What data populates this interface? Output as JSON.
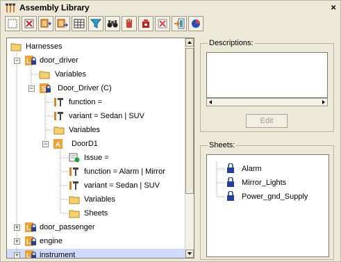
{
  "window": {
    "title": "Assembly Library",
    "close_glyph": "×"
  },
  "toolbar": {
    "buttons": [
      "select-all",
      "delete",
      "copy-to",
      "move-to",
      "table",
      "filter",
      "find",
      "hand",
      "export",
      "remove",
      "import",
      "properties"
    ]
  },
  "tree": {
    "items": [
      {
        "label": "Harnesses",
        "icon": "folder-icon"
      },
      {
        "label": "door_driver",
        "icon": "library-lock-icon"
      },
      {
        "label": "Variables",
        "icon": "folder-icon"
      },
      {
        "label": "Door_Driver (C)",
        "icon": "component-icon"
      },
      {
        "label": "function =",
        "icon": "property-icon"
      },
      {
        "label": "variant = Sedan | SUV",
        "icon": "property-icon"
      },
      {
        "label": "Variables",
        "icon": "folder-icon"
      },
      {
        "label": "DoorD1",
        "icon": "assembly-icon"
      },
      {
        "label": "Issue =",
        "icon": "issue-icon"
      },
      {
        "label": "function = Alarm | Mirror",
        "icon": "property-icon"
      },
      {
        "label": "variant = Sedan | SUV",
        "icon": "property-icon"
      },
      {
        "label": "Variables",
        "icon": "folder-icon"
      },
      {
        "label": "Sheets",
        "icon": "folder-icon"
      },
      {
        "label": "door_passenger",
        "icon": "library-lock-icon"
      },
      {
        "label": "engine",
        "icon": "library-lock-icon"
      },
      {
        "label": "instrument",
        "icon": "library-lock-icon"
      }
    ]
  },
  "descriptions": {
    "legend": "Descriptions:",
    "edit_label": "Edit"
  },
  "sheets": {
    "legend": "Sheets:",
    "items": [
      {
        "label": "Alarm"
      },
      {
        "label": "Mirror_Lights"
      },
      {
        "label": "Power_gnd_Supply"
      }
    ]
  },
  "colors": {
    "accent_orange": "#f0a030",
    "selection": "#cfdcff",
    "lock_blue": "#2040a0"
  }
}
